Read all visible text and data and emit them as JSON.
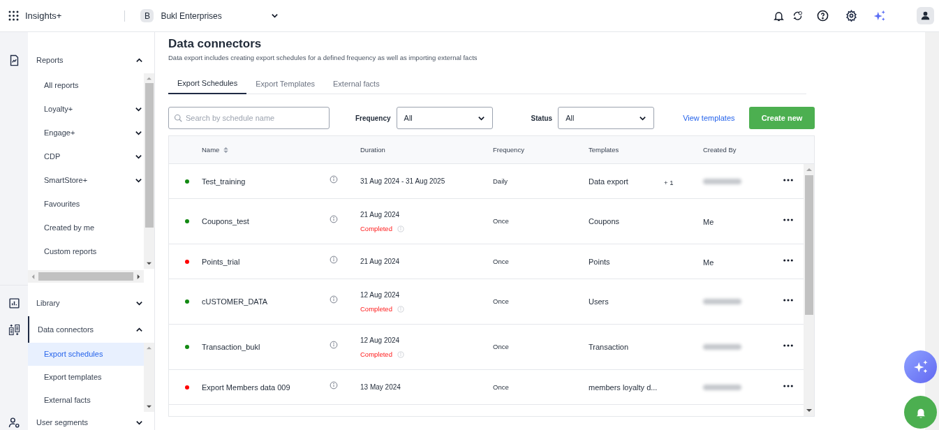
{
  "header": {
    "app_name": "Insights+",
    "org_initial": "B",
    "org_name": "Bukl Enterprises"
  },
  "sidebar": {
    "sections": [
      {
        "label": "Reports",
        "expanded": true,
        "children": [
          {
            "label": "All reports",
            "has_children": false
          },
          {
            "label": "Loyalty+",
            "has_children": true
          },
          {
            "label": "Engage+",
            "has_children": true
          },
          {
            "label": "CDP",
            "has_children": true
          },
          {
            "label": "SmartStore+",
            "has_children": true
          },
          {
            "label": "Favourites",
            "has_children": false
          },
          {
            "label": "Created by me",
            "has_children": false
          },
          {
            "label": "Custom reports",
            "has_children": false
          }
        ]
      },
      {
        "label": "Library",
        "expanded": false
      },
      {
        "label": "Data connectors",
        "expanded": true,
        "children": [
          {
            "label": "Export schedules",
            "selected": true
          },
          {
            "label": "Export templates",
            "selected": false
          },
          {
            "label": "External facts",
            "selected": false
          }
        ]
      },
      {
        "label": "User segments",
        "expanded": false
      }
    ]
  },
  "page": {
    "title": "Data connectors",
    "subtitle": "Data export includes creating export schedules for a defined frequency as well as importing external facts"
  },
  "tabs": [
    {
      "label": "Export Schedules",
      "selected": true
    },
    {
      "label": "Export Templates",
      "selected": false
    },
    {
      "label": "External facts",
      "selected": false
    }
  ],
  "filters": {
    "search": {
      "placeholder": "Search by schedule name"
    },
    "frequency": {
      "label": "Frequency",
      "value": "All"
    },
    "status": {
      "label": "Status",
      "value": "All"
    },
    "link": "View templates",
    "button": "Create new"
  },
  "table": {
    "columns": [
      "Name",
      "Duration",
      "Frequency",
      "Templates",
      "Created By"
    ],
    "rows": [
      {
        "color": "#138a13",
        "name": "Test_training",
        "duration": "31 Aug 2024 - 31 Aug 2025",
        "frequency": "Daily",
        "template": "Data export",
        "template_extra": "+ 1",
        "created_by_blurred": true
      },
      {
        "color": "#138a13",
        "name": "Coupons_test",
        "duration": "21 Aug 2024",
        "status": "Completed",
        "frequency": "Once",
        "template": "Coupons",
        "created_by": "Me",
        "created_by_blurred": false
      },
      {
        "color": "#ff0000",
        "name": "Points_trial",
        "duration": "21 Aug 2024",
        "frequency": "Once",
        "template": "Points",
        "created_by": "Me",
        "created_by_blurred": false
      },
      {
        "color": "#138a13",
        "name": "cUSTOMER_DATA",
        "duration": "12 Aug 2024",
        "status": "Completed",
        "frequency": "Once",
        "template": "Users",
        "created_by_blurred": true
      },
      {
        "color": "#138a13",
        "name": "Transaction_bukl",
        "duration": "12 Aug 2024",
        "status": "Completed",
        "frequency": "Once",
        "template": "Transaction",
        "created_by_blurred": true
      },
      {
        "color": "#ff0000",
        "name": "Export Members data 009",
        "duration": "13 May 2024",
        "frequency": "Once",
        "template": "members loyalty d...",
        "created_by_blurred": true
      }
    ]
  }
}
